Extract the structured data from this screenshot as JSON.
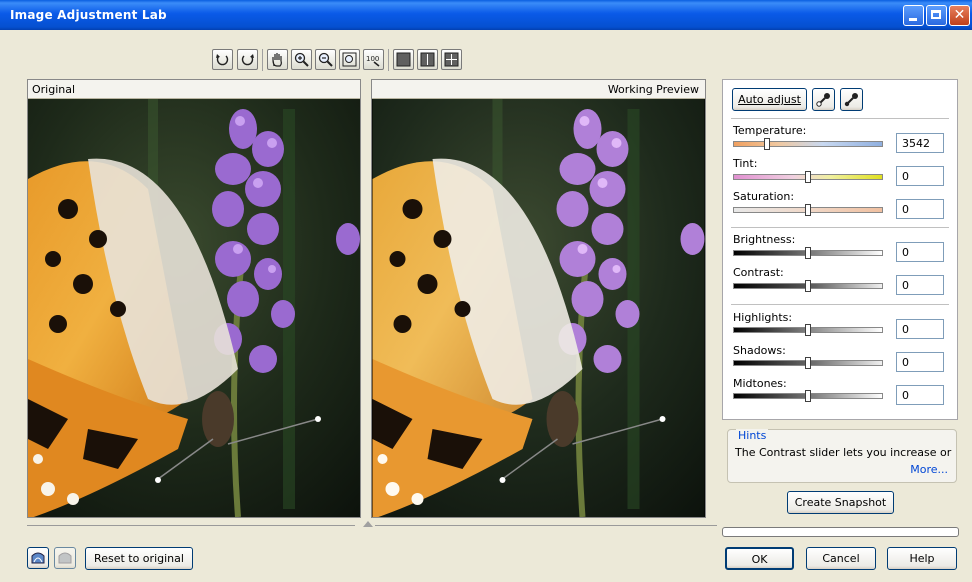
{
  "window": {
    "title": "Image Adjustment Lab"
  },
  "toolbar": {
    "tools": [
      "rotate-left",
      "rotate-right",
      "pan",
      "zoom-in",
      "zoom-out",
      "zoom-fit",
      "zoom-100",
      "single-view",
      "split-view",
      "full-view"
    ]
  },
  "panes": {
    "original_label": "Original",
    "preview_label": "Working Preview"
  },
  "controls": {
    "auto_adjust_label": "Auto adjust",
    "temperature": {
      "label": "Temperature:",
      "value": "3542",
      "level": 0.21
    },
    "tint": {
      "label": "Tint:",
      "value": "0",
      "level": 0.5
    },
    "saturation": {
      "label": "Saturation:",
      "value": "0",
      "level": 0.5
    },
    "brightness": {
      "label": "Brightness:",
      "value": "0",
      "level": 0.5
    },
    "contrast": {
      "label": "Contrast:",
      "value": "0",
      "level": 0.5
    },
    "highlights": {
      "label": "Highlights:",
      "value": "0",
      "level": 0.5
    },
    "shadows": {
      "label": "Shadows:",
      "value": "0",
      "level": 0.5
    },
    "midtones": {
      "label": "Midtones:",
      "value": "0",
      "level": 0.5
    }
  },
  "hints": {
    "title": "Hints",
    "text": "The Contrast slider lets you increase or",
    "more_label": "More..."
  },
  "snapshot_label": "Create Snapshot",
  "bottom": {
    "reset_label": "Reset to original",
    "ok_label": "OK",
    "cancel_label": "Cancel",
    "help_label": "Help"
  },
  "colors": {
    "title_blue": "#0a5ae8",
    "link_blue": "#0046d5",
    "face": "#ece9d8"
  }
}
